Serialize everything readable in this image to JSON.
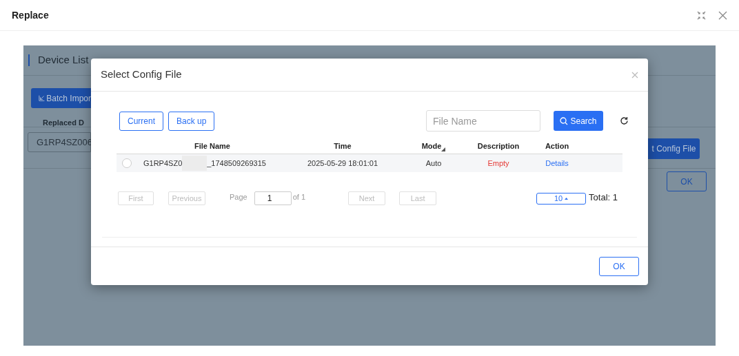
{
  "window": {
    "title": "Replace"
  },
  "background": {
    "section_title": "Device List",
    "batch_button": "Batch Impor",
    "column_header": "Replaced D",
    "device_field_value": "G1RP4SZ006",
    "config_button": "t Config File",
    "ok_button": "OK"
  },
  "dialog": {
    "title": "Select Config File",
    "tabs": [
      {
        "label": "Current",
        "selected": false
      },
      {
        "label": "Back up",
        "selected": false
      }
    ],
    "search": {
      "placeholder": "File Name",
      "button": "Search"
    },
    "table": {
      "columns": [
        "File Name",
        "Time",
        "Mode",
        "Description",
        "Action"
      ],
      "rows": [
        {
          "selected": false,
          "file_name_start": "G1RP4SZ0",
          "file_name_end": "_1748509269315",
          "time": "2025-05-29 18:01:01",
          "mode": "Auto",
          "description": "Empty",
          "action": "Details"
        }
      ]
    },
    "pagination": {
      "first": "First",
      "previous": "Previous",
      "page_label": "Page",
      "page_value": "1",
      "of_total": "of 1",
      "next": "Next",
      "last": "Last",
      "page_size": "10",
      "total": "Total: 1"
    },
    "ok_button": "OK"
  }
}
